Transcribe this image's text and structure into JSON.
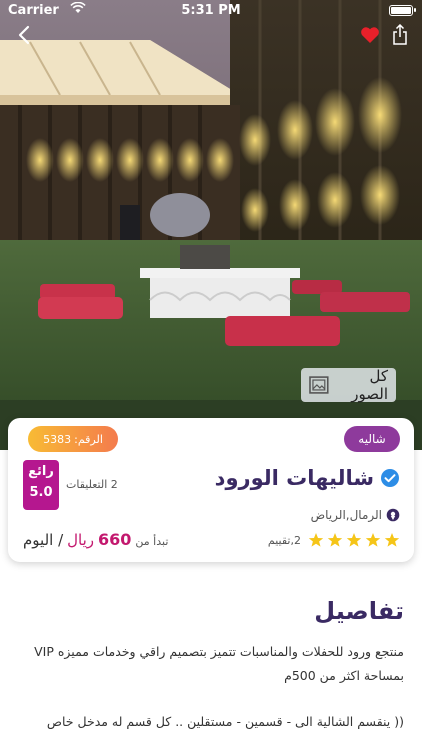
{
  "status_bar": {
    "carrier": "Carrier",
    "time": "5:31 PM"
  },
  "hero": {
    "all_photos_label": "كل الصور"
  },
  "card": {
    "id_label": "الرقم:",
    "id_value": "5383",
    "type_badge": "شاليه",
    "rating_word": "رائع",
    "rating_score": "5.0",
    "comments": "2 التعليقات",
    "title": "شاليهات الورود",
    "location": "الرمال,الرياض",
    "stars": 5,
    "reviews": "2,تقييم",
    "price_from": "تبدأ من",
    "price": "660",
    "price_unit": "ريال",
    "price_period": "/ اليوم"
  },
  "details": {
    "title": "تفاصيل",
    "paragraph1": "منتجع ورود للحفلات والمناسبات تتميز بتصميم راقي وخدمات مميزه VIP بمساحة اكثر من 500م",
    "paragraph2": "(( ينقسم الشالية الى - قسمين - مستقلين .. كل قسم له مدخل خاص"
  },
  "colors": {
    "primary_dark": "#3a2a63",
    "accent_purple": "#8e3a9c",
    "rating_magenta": "#b5178f",
    "price_magenta": "#c3186e",
    "badge_gradient_start": "#f8bb34",
    "badge_gradient_end": "#f47b4d",
    "star_yellow": "#f5c518",
    "heart_red": "#e8202a"
  }
}
